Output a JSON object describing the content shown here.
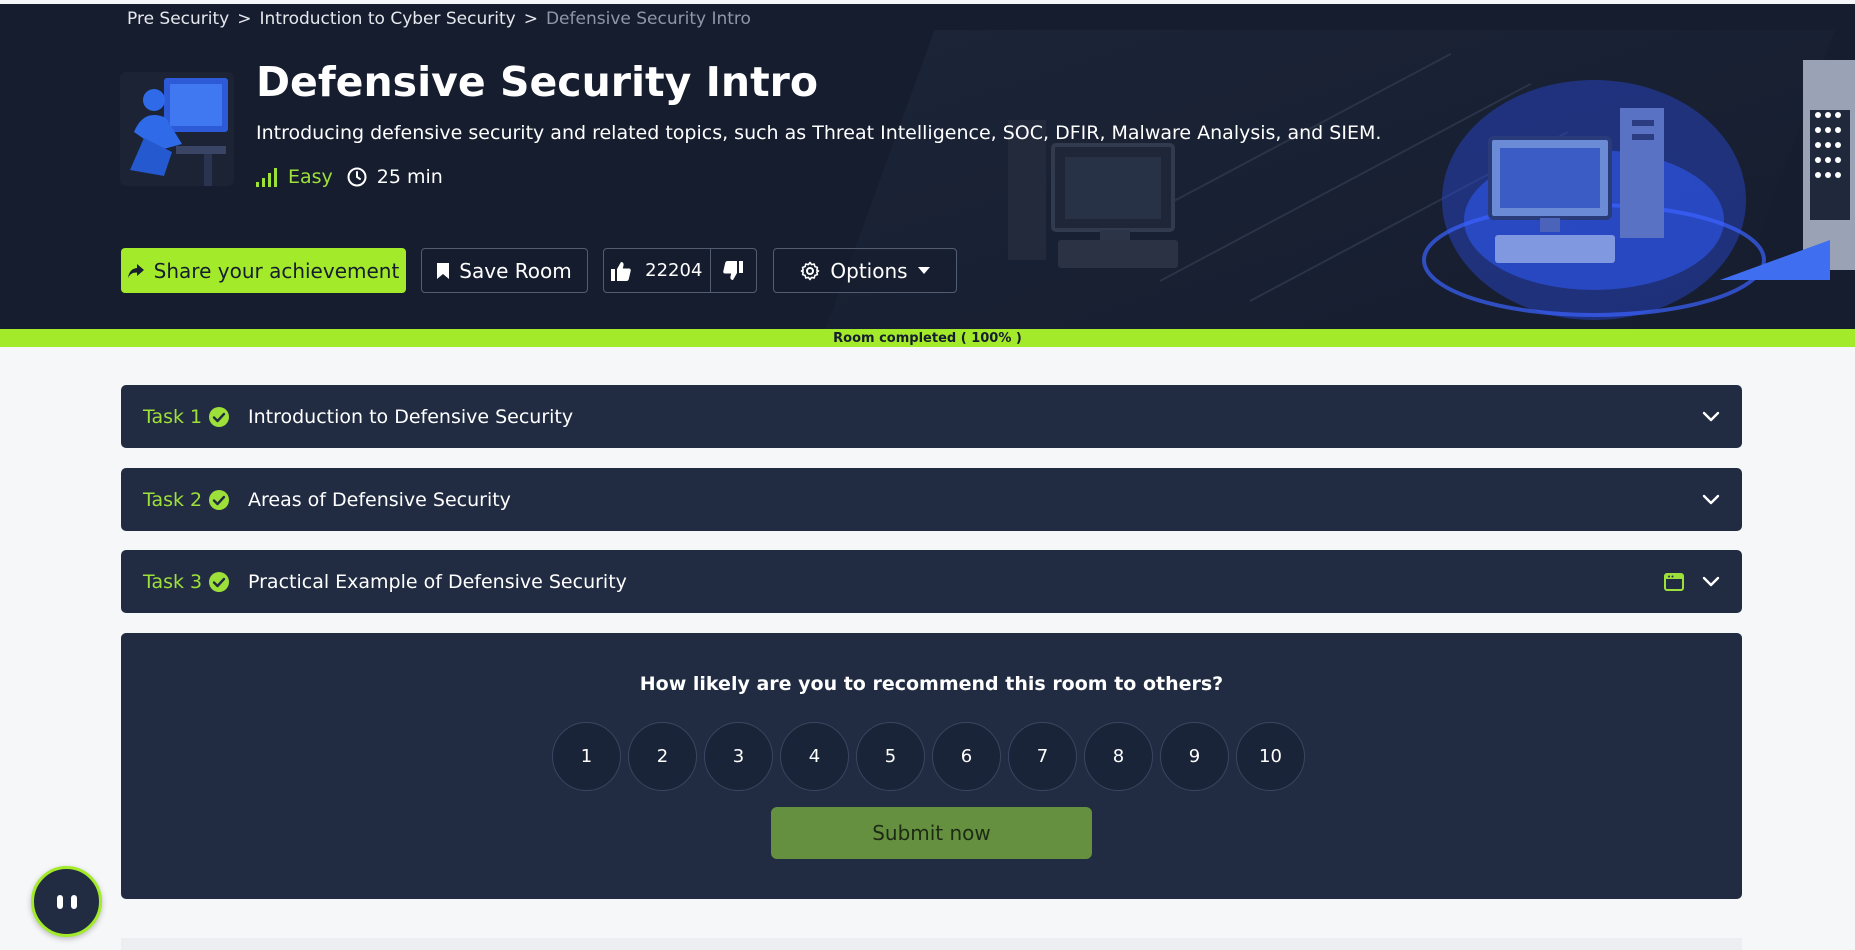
{
  "breadcrumb": {
    "items": [
      "Pre Security",
      "Introduction to Cyber Security"
    ],
    "current": "Defensive Security Intro",
    "separator": ">"
  },
  "room": {
    "title": "Defensive Security Intro",
    "description": "Introducing defensive security and related topics, such as Threat Intelligence, SOC, DFIR, Malware Analysis, and SIEM.",
    "difficulty": "Easy",
    "duration": "25 min"
  },
  "actions": {
    "share_label": "Share your achievement",
    "save_label": "Save Room",
    "like_count": "22204",
    "options_label": "Options"
  },
  "progress": {
    "label": "Room completed ( 100% )",
    "percent": 100
  },
  "tasks": [
    {
      "number": "Task 1",
      "title": "Introduction to Defensive Security",
      "completed": true,
      "has_machine": false
    },
    {
      "number": "Task 2",
      "title": "Areas of Defensive Security",
      "completed": true,
      "has_machine": false
    },
    {
      "number": "Task 3",
      "title": "Practical Example of Defensive Security",
      "completed": true,
      "has_machine": true
    }
  ],
  "rating": {
    "question": "How likely are you to recommend this room to others?",
    "scores": [
      "1",
      "2",
      "3",
      "4",
      "5",
      "6",
      "7",
      "8",
      "9",
      "10"
    ],
    "submit_label": "Submit now"
  },
  "colors": {
    "accent": "#a3ea2a",
    "hero_bg": "#161d2e",
    "panel_bg": "#212c42",
    "submit_bg": "#65903f"
  },
  "icons": {
    "share": "share-icon",
    "save": "bookmark-icon",
    "like": "thumbs-up-icon",
    "dislike": "thumbs-down-icon",
    "options": "gear-icon",
    "expand": "chevron-down-icon",
    "check": "check-circle-icon",
    "machine": "browser-window-icon",
    "chat": "assistant-icon"
  }
}
